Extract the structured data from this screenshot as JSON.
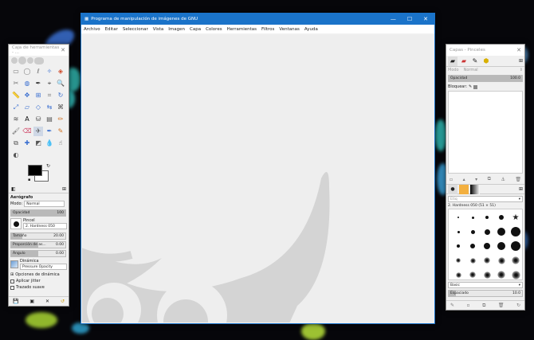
{
  "colors": {
    "accent": "#1a73c9",
    "canvas": "#eeeeee",
    "wilber": "#d4d4d4",
    "panel": "#f0f0f0"
  },
  "toolbox": {
    "title": "Caja de herramientas - ...",
    "tool_icons": [
      "rect-select-icon",
      "ellipse-select-icon",
      "lasso-icon",
      "fuzzy-select-icon",
      "color-select-icon",
      "scissors-icon",
      "foreground-select-icon",
      "paths-icon",
      "color-picker-icon",
      "zoom-icon",
      "measure-icon",
      "move-icon",
      "align-icon",
      "crop-icon",
      "rotate-icon",
      "scale-icon",
      "shear-icon",
      "perspective-icon",
      "flip-icon",
      "cage-icon",
      "warp-icon",
      "text-icon",
      "bucket-fill-icon",
      "blend-icon",
      "pencil-icon",
      "paintbrush-icon",
      "eraser-icon",
      "airbrush-icon",
      "ink-icon",
      "mypaint-icon",
      "clone-icon",
      "heal-icon",
      "perspective-clone-icon",
      "blur-icon",
      "smudge-icon",
      "dodge-icon"
    ],
    "options_title": "Aerógrafo",
    "mode_label": "Modo:",
    "mode_value": "Normal",
    "opacity_label": "Opacidad",
    "opacity_value": "100",
    "brush_label": "Pincel",
    "brush_value": "2. Hardness 050",
    "size_label": "Tamaño",
    "size_value": "20.00",
    "aspect_label": "Proporción de as...",
    "aspect_value": "0.00",
    "angle_label": "Ángulo",
    "angle_value": "0.00",
    "dynamics_label": "Dinámica",
    "dynamics_value": "Pressure Opacity",
    "dynamics_options": "Opciones de dinámica",
    "jitter_label": "Aplicar jitter",
    "smooth_label": "Trazado suave"
  },
  "main": {
    "title": "Programa de manipulación de imágenes de GNU",
    "menu": [
      "Archivo",
      "Editar",
      "Seleccionar",
      "Vista",
      "Imagen",
      "Capa",
      "Colores",
      "Herramientas",
      "Filtros",
      "Ventanas",
      "Ayuda"
    ],
    "minimize": "—",
    "maximize": "☐",
    "close": "✕"
  },
  "layers": {
    "title": "Capas - Pinceles",
    "mode_label": "Modo",
    "mode_value": "Normal",
    "opacity_label": "Opacidad",
    "opacity_value": "100.0",
    "lock_label": "Bloquear:",
    "tag_placeholder": "Etiq",
    "brush_name": "2. Hardness 050 (51 × 51)",
    "preset_value": "Basic",
    "spacing_label": "Espaciado",
    "spacing_value": "10.0"
  }
}
